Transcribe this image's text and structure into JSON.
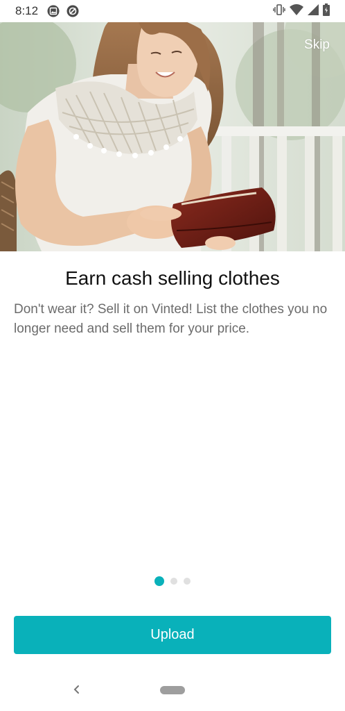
{
  "status_bar": {
    "time": "8:12",
    "left_icons": [
      "photo-icon",
      "at-sign-icon"
    ],
    "right_icons": [
      "vibrate-icon",
      "wifi-icon",
      "signal-icon",
      "battery-icon"
    ]
  },
  "hero": {
    "image": "woman-holding-wallet-photo",
    "skip_label": "Skip"
  },
  "content": {
    "title": "Earn cash selling clothes",
    "description": "Don't wear it? Sell it on Vinted! List the clothes you no longer need and sell them for your price."
  },
  "pagination": {
    "count": 3,
    "active_index": 0
  },
  "actions": {
    "upload_label": "Upload"
  },
  "colors": {
    "accent": "#09b1ba",
    "dot_inactive": "#e0e0e0",
    "title_text": "#111111",
    "body_text": "#6b6b6b"
  },
  "nav": {
    "icons": [
      "back-chevron-icon",
      "home-pill-icon"
    ]
  }
}
